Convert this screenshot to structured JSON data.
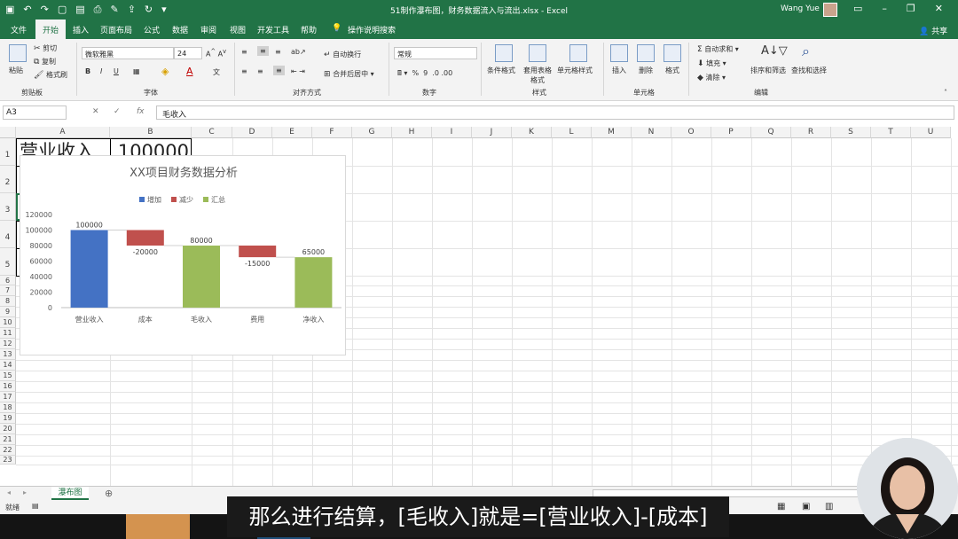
{
  "window": {
    "title": "51制作瀑布图，财务数据流入与流出.xlsx - Excel",
    "user": "Wang Yue"
  },
  "ribbon_tabs": [
    "文件",
    "开始",
    "插入",
    "页面布局",
    "公式",
    "数据",
    "审阅",
    "视图",
    "开发工具",
    "帮助",
    "操作说明搜索"
  ],
  "share_label": "共享",
  "ribbon": {
    "clipboard": {
      "paste": "粘贴",
      "cut": "剪切",
      "copy": "复制",
      "format_painter": "格式刷",
      "group": "剪贴板"
    },
    "font": {
      "name": "微软雅黑",
      "size": "24",
      "group": "字体"
    },
    "alignment": {
      "wrap": "自动换行",
      "merge": "合并后居中",
      "group": "对齐方式"
    },
    "number": {
      "format": "常规",
      "group": "数字"
    },
    "styles": {
      "conditional": "条件格式",
      "table": "套用表格格式",
      "cell_styles": "单元格样式",
      "group": "样式"
    },
    "cells": {
      "insert": "插入",
      "delete": "删除",
      "format": "格式",
      "group": "单元格"
    },
    "editing": {
      "autosum": "自动求和",
      "fill": "填充",
      "clear": "清除",
      "sort": "排序和筛选",
      "find": "查找和选择",
      "group": "编辑"
    }
  },
  "formula_bar": {
    "name_box": "A3",
    "content": "毛收入"
  },
  "columns": [
    "A",
    "B",
    "C",
    "D",
    "E",
    "F",
    "G",
    "H",
    "I",
    "J",
    "K",
    "L",
    "M",
    "N",
    "O",
    "P",
    "Q",
    "R",
    "S",
    "T",
    "U"
  ],
  "rows": [
    "1",
    "2",
    "3",
    "4",
    "5",
    "6",
    "7",
    "8",
    "9",
    "10",
    "11",
    "12",
    "13",
    "14",
    "15",
    "16",
    "17",
    "18",
    "19",
    "20",
    "21",
    "22",
    "23"
  ],
  "table": [
    {
      "label": "营业收入",
      "value": "100000"
    },
    {
      "label": "成本",
      "value": "-20000"
    },
    {
      "label": "毛收入",
      "value": "80000"
    },
    {
      "label": "费用",
      "value": "-15000"
    },
    {
      "label": "净收入",
      "value": "65000"
    }
  ],
  "sheet_tab": "瀑布图",
  "status": "就绪",
  "subtitle": "那么进行结算，[毛收入]就是=[营业收入]-[成本]",
  "chart_data": {
    "type": "bar",
    "title": "XX项目财务数据分析",
    "categories": [
      "营业收入",
      "成本",
      "毛收入",
      "费用",
      "净收入"
    ],
    "values": [
      100000,
      -20000,
      80000,
      -15000,
      65000
    ],
    "data_labels": [
      "100000",
      "-20000",
      "80000",
      "-15000",
      "65000"
    ],
    "base": [
      0,
      80000,
      0,
      65000,
      0
    ],
    "kind": [
      "增加",
      "减少",
      "汇总",
      "减少",
      "汇总"
    ],
    "legend": [
      {
        "name": "增加",
        "color": "#4472c4"
      },
      {
        "name": "减少",
        "color": "#c0504d"
      },
      {
        "name": "汇总",
        "color": "#9bbb59"
      }
    ],
    "legend_position": "top",
    "yticks": [
      "0",
      "20000",
      "40000",
      "60000",
      "80000",
      "100000",
      "120000"
    ],
    "ylim": [
      0,
      120000
    ],
    "grid": false
  }
}
